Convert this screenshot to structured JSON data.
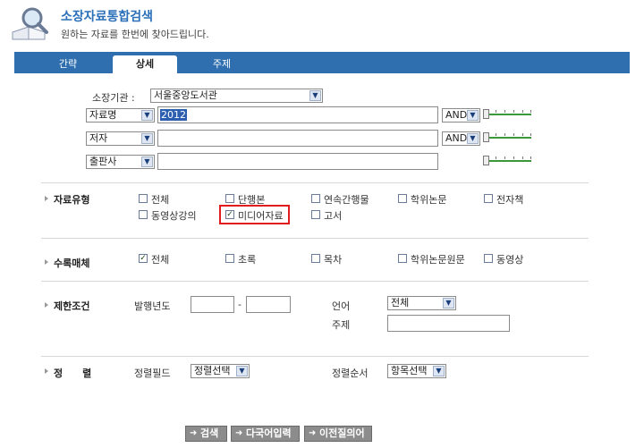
{
  "header": {
    "title": "소장자료통합검색",
    "subtitle": "원하는 자료를 한번에 찾아드립니다."
  },
  "tabs": [
    {
      "label": "간략",
      "active": false
    },
    {
      "label": "상세",
      "active": true
    },
    {
      "label": "주제",
      "active": false
    }
  ],
  "search": {
    "library_label": "소장기관 :",
    "library_value": "서울중앙도서관",
    "rows": [
      {
        "field": "자료명",
        "value": "2012",
        "operator": "AND"
      },
      {
        "field": "저자",
        "value": "",
        "operator": "AND"
      },
      {
        "field": "출판사",
        "value": ""
      }
    ]
  },
  "material_type": {
    "label": "자료유형",
    "options": [
      {
        "label": "전체",
        "checked": false
      },
      {
        "label": "단행본",
        "checked": false
      },
      {
        "label": "연속간행물",
        "checked": false
      },
      {
        "label": "학위논문",
        "checked": false
      },
      {
        "label": "전자책",
        "checked": false
      },
      {
        "label": "동영상강의",
        "checked": false
      },
      {
        "label": "미디어자료",
        "checked": true
      },
      {
        "label": "고서",
        "checked": false
      }
    ]
  },
  "media": {
    "label": "수록매체",
    "options": [
      {
        "label": "전체",
        "checked": true
      },
      {
        "label": "초록",
        "checked": false
      },
      {
        "label": "목차",
        "checked": false
      },
      {
        "label": "학위논문원문",
        "checked": false
      },
      {
        "label": "동영상",
        "checked": false
      }
    ]
  },
  "limits": {
    "label": "제한조건",
    "year_label": "발행년도",
    "year_from": "",
    "year_to": "",
    "dash": "-",
    "language_label": "언어",
    "language_value": "전체",
    "subject_label": "주제",
    "subject_value": ""
  },
  "sort": {
    "label": "정　　렬",
    "field_label": "정렬필드",
    "field_value": "정렬선택",
    "order_label": "정렬순서",
    "order_value": "항목선택"
  },
  "buttons": {
    "search": "검색",
    "multilang": "다국어입력",
    "previous": "이전질의어"
  },
  "colors": {
    "tab_bar": "#2f6fb0",
    "title": "#2a6fb8",
    "highlight_box": "#e21c1c",
    "button": "#8c8c8c"
  }
}
